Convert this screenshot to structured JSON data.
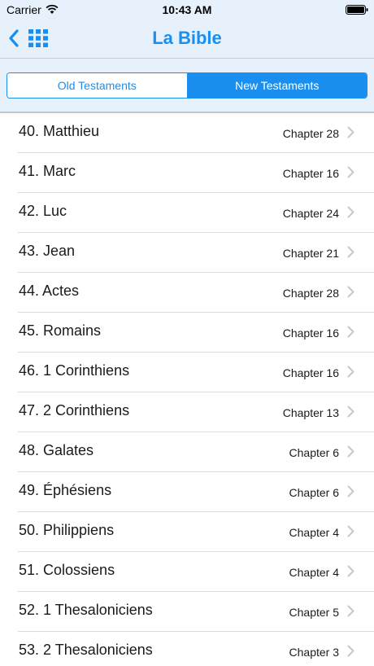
{
  "status_bar": {
    "carrier": "Carrier",
    "time": "10:43 AM",
    "icons": [
      "wifi-icon",
      "battery-icon"
    ]
  },
  "nav": {
    "title": "La Bible",
    "back_icon": "chevron-left-icon",
    "menu_icon": "grid-icon"
  },
  "colors": {
    "accent": "#1a8ff0",
    "header_bg": "#e6f1fb"
  },
  "segments": {
    "old": "Old Testaments",
    "new": "New Testaments",
    "selected": "New Testaments"
  },
  "books": [
    {
      "title": "40. Matthieu",
      "chapters": "Chapter 28"
    },
    {
      "title": "41. Marc",
      "chapters": "Chapter 16"
    },
    {
      "title": "42. Luc",
      "chapters": "Chapter 24"
    },
    {
      "title": "43. Jean",
      "chapters": "Chapter 21"
    },
    {
      "title": "44. Actes",
      "chapters": "Chapter 28"
    },
    {
      "title": "45. Romains",
      "chapters": "Chapter 16"
    },
    {
      "title": "46. 1 Corinthiens",
      "chapters": "Chapter 16"
    },
    {
      "title": "47. 2 Corinthiens",
      "chapters": "Chapter 13"
    },
    {
      "title": "48. Galates",
      "chapters": "Chapter 6"
    },
    {
      "title": "49. Éphésiens",
      "chapters": "Chapter 6"
    },
    {
      "title": "50. Philippiens",
      "chapters": "Chapter 4"
    },
    {
      "title": "51. Colossiens",
      "chapters": "Chapter 4"
    },
    {
      "title": "52. 1 Thesaloniciens",
      "chapters": "Chapter 5"
    },
    {
      "title": "53. 2 Thesaloniciens",
      "chapters": "Chapter 3"
    }
  ]
}
